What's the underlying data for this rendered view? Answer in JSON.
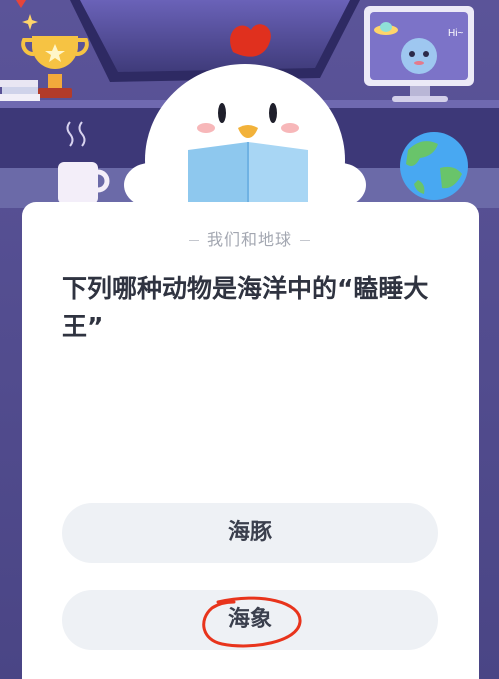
{
  "quiz": {
    "category": "我们和地球",
    "question": "下列哪种动物是海洋中的“瞌睡大王”",
    "options": [
      {
        "label": "海豚"
      },
      {
        "label": "海象"
      }
    ]
  },
  "illustration": {
    "speech_bubble": "Hi~"
  },
  "colors": {
    "background": "#4e4a8e",
    "card": "#ffffff",
    "option_bg": "#eef1f5",
    "question_text": "#2f3340",
    "category_text": "#a3a7b1",
    "annotation": "#e8341c"
  }
}
